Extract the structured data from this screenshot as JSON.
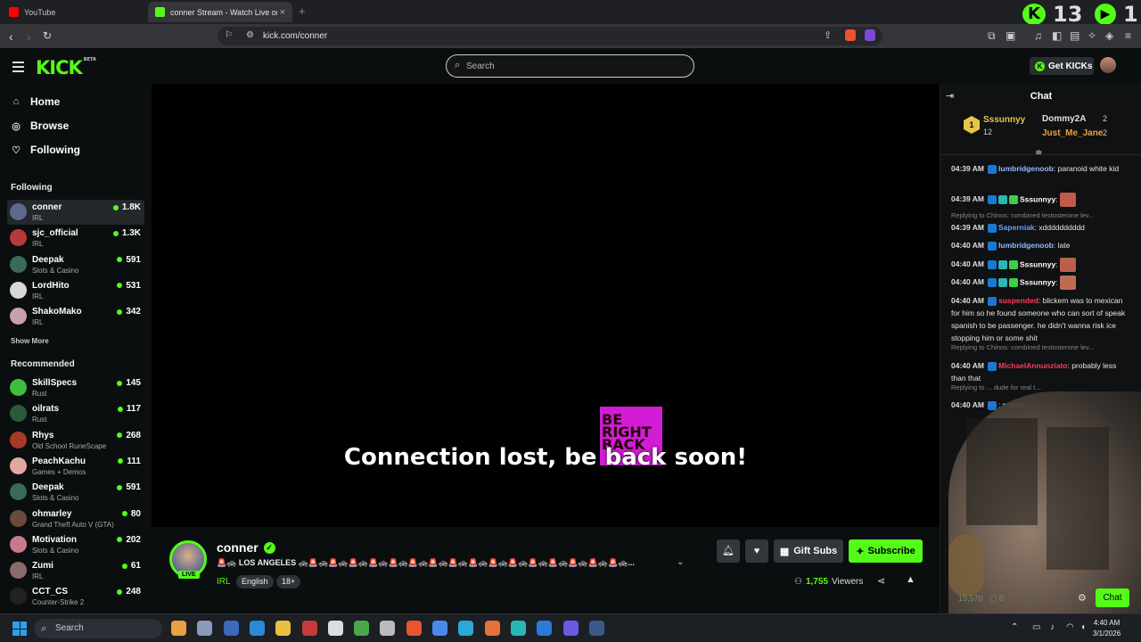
{
  "browser": {
    "tabs": [
      {
        "label": "YouTube"
      },
      {
        "label": "conner Stream - Watch Live on K",
        "close": "×"
      }
    ],
    "new_tab": "+",
    "url": "kick.com/conner",
    "ext_counter_1": "13",
    "ext_counter_2": "1"
  },
  "header": {
    "logo": "KICK",
    "logo_badge": "BETA",
    "search_placeholder": "Search",
    "get_kicks": "Get KICKs"
  },
  "sidebar": {
    "nav": [
      {
        "label": "Home",
        "icon": "home-icon"
      },
      {
        "label": "Browse",
        "icon": "compass-icon"
      },
      {
        "label": "Following",
        "icon": "heart-icon"
      }
    ],
    "following_title": "Following",
    "following": [
      {
        "name": "conner",
        "category": "IRL",
        "viewers": "1.8K",
        "color": "#5b6a8a"
      },
      {
        "name": "sjc_official",
        "category": "IRL",
        "viewers": "1.3K",
        "color": "#b53a3a"
      },
      {
        "name": "Deepak",
        "category": "Slots & Casino",
        "viewers": "591",
        "color": "#3a6a5a"
      },
      {
        "name": "LordHito",
        "category": "IRL",
        "viewers": "531",
        "color": "#d8d8d8"
      },
      {
        "name": "ShakoMako",
        "category": "IRL",
        "viewers": "342",
        "color": "#c8a0a8"
      }
    ],
    "show_more": "Show More",
    "recommended_title": "Recommended",
    "recommended": [
      {
        "name": "SkillSpecs",
        "category": "Rust",
        "viewers": "145",
        "color": "#3cbf3c"
      },
      {
        "name": "oilrats",
        "category": "Rust",
        "viewers": "117",
        "color": "#2a5a3a"
      },
      {
        "name": "Rhys",
        "category": "Old School RuneScape",
        "viewers": "268",
        "color": "#a83a2a"
      },
      {
        "name": "PeachKachu",
        "category": "Games + Demos",
        "viewers": "111",
        "color": "#e0a8a0"
      },
      {
        "name": "Deepak",
        "category": "Slots & Casino",
        "viewers": "591",
        "color": "#3a6a5a"
      },
      {
        "name": "ohmarley",
        "category": "Grand Theft Auto V (GTA)",
        "viewers": "80",
        "color": "#6a4a3a"
      },
      {
        "name": "Motivation",
        "category": "Slots & Casino",
        "viewers": "202",
        "color": "#c87a8a"
      },
      {
        "name": "Zumi",
        "category": "IRL",
        "viewers": "61",
        "color": "#8a6a6a"
      },
      {
        "name": "CCT_CS",
        "category": "Counter-Strike 2",
        "viewers": "248",
        "color": "#222222"
      }
    ]
  },
  "player": {
    "overlay_text": "Connection lost, be back soon!",
    "brb_text": "BE RIGHT BACK"
  },
  "stream": {
    "channel": "conner",
    "live_label": "LIVE",
    "title": "🚨🚓 LOS ANGELES 🚓🚨🚓🚨🚓🚨🚓🚨🚓🚨🚓🚨🚓🚨🚓🚨🚓🚨🚓🚨🚓🚨🚓🚨🚓🚨🚓🚨🚓🚨🚓🚨🚓...",
    "category": "IRL",
    "tags": [
      "English",
      "18+"
    ],
    "gift_subs": "Gift Subs",
    "subscribe": "Subscribe",
    "viewers": "1,755",
    "viewers_label": "Viewers"
  },
  "chat": {
    "title": "Chat",
    "leaderboard": {
      "first": {
        "rank": "1",
        "name": "Sssunnyy",
        "count": "12"
      },
      "second": {
        "name": "Dommy2A",
        "count": "2"
      },
      "third": {
        "name": "Just_Me_Jane",
        "count": "2"
      }
    },
    "messages": [
      {
        "time": "04:39 AM",
        "user": "lumbridgenoob",
        "user_color": "#9ab8ff",
        "text": "paranoid white kid"
      },
      {
        "time": "04:39 AM",
        "user": "Sssunnyy",
        "user_color": "#ffffff",
        "text": ""
      },
      {
        "reply": "Replying to Chinos: combined testosterone lev..."
      },
      {
        "time": "04:39 AM",
        "user": "Saperniak",
        "user_color": "#6aa0ff",
        "text": "xdddddddddd"
      },
      {
        "time": "04:40 AM",
        "user": "lumbridgenoob",
        "user_color": "#9ab8ff",
        "text": "late"
      },
      {
        "time": "04:40 AM",
        "user": "Sssunnyy",
        "user_color": "#ffffff",
        "text": ""
      },
      {
        "time": "04:40 AM",
        "user": "Sssunnyy",
        "user_color": "#ffffff",
        "text": ""
      },
      {
        "time": "04:40 AM",
        "user": "suspended",
        "user_color": "#ff3a5a",
        "text": "blickem was to mexican for him so he found someone who can sort of speak spanish to be passenger. he didn't wanna risk ice stopping him or some shit"
      },
      {
        "reply": "Replying to Chinos: combined testosterone lev..."
      },
      {
        "time": "04:40 AM",
        "user": "MichaelAnnunziato",
        "user_color": "#ff3a5a",
        "text": "probably less than that"
      },
      {
        "reply": "Replying to ... dude for real t..."
      },
      {
        "time": "04:40 AM",
        "user": "",
        "user_color": "#ff3a5a",
        "text": "masks,"
      }
    ],
    "points": "15,570",
    "points2": "0",
    "chat_button": "Chat"
  },
  "taskbar": {
    "search": "Search",
    "time": "4:40 AM",
    "date": "3/1/2026"
  },
  "colors": {
    "accent": "#53fc18",
    "background": "#0b0e0f"
  }
}
